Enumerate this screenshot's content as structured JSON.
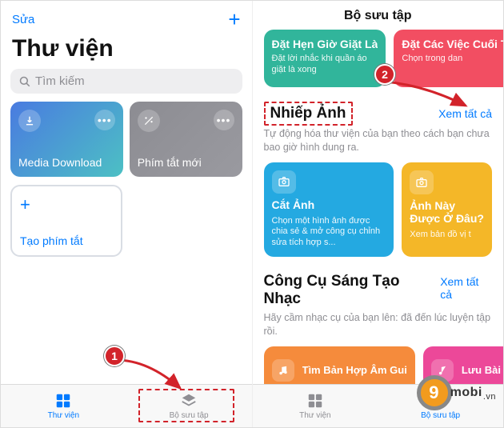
{
  "left": {
    "edit": "Sửa",
    "title": "Thư viện",
    "search_placeholder": "Tìm kiếm",
    "card_media": "Media Download",
    "card_new": "Phím tắt mới",
    "create": "Tạo phím tắt",
    "tab_library": "Thư viện",
    "tab_gallery": "Bộ sưu tập"
  },
  "right": {
    "header": "Bộ sưu tập",
    "laundry_title": "Đặt Hẹn Giờ Giặt Là",
    "laundry_sub": "Đặt lời nhắc khi quần áo giặt là xong",
    "weekend_title": "Đặt Các Việc Cuối Tuần",
    "weekend_sub": "Chọn trong dan",
    "photo_section": "Nhiếp Ảnh",
    "see_all": "Xem tất cả",
    "photo_sub": "Tự động hóa thư viện của bạn theo cách bạn chưa bao giờ hình dung ra.",
    "crop_title": "Cắt Ảnh",
    "crop_sub": "Chọn một hình ảnh được chia sẻ & mở công cụ chỉnh sửa tích hợp s...",
    "where_title": "Ảnh Này Được Ở Đâu?",
    "where_sub": "Xem bản đồ vị t",
    "music_section": "Công Cụ Sáng Tạo Nhạc",
    "music_sub": "Hãy cầm nhạc cụ của bạn lên: đã đến lúc luyện tập rồi.",
    "chord_title": "Tìm Bản Hợp Âm Gui",
    "save_title": "Lưu Bài Hát",
    "tab_library": "Thư viện",
    "tab_gallery": "Bộ sưu tập"
  },
  "annotations": {
    "badge1": "1",
    "badge2": "2"
  },
  "watermark": {
    "digit": "9",
    "text": "mobi",
    "suffix": ".vn"
  }
}
